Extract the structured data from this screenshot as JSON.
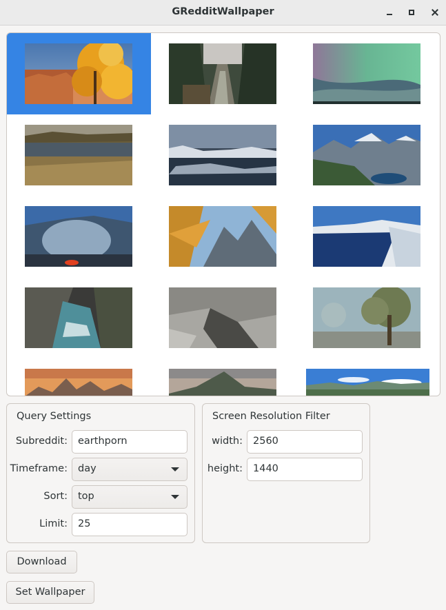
{
  "window": {
    "title": "GRedditWallpaper"
  },
  "gallery": {
    "selected_index": 0,
    "colors": {
      "selection": "#3584e4"
    },
    "thumbnails": [
      {
        "name": "canyon-autumn-tree"
      },
      {
        "name": "forest-stream"
      },
      {
        "name": "aurora-borealis"
      },
      {
        "name": "marsh-rainbow"
      },
      {
        "name": "icy-fjord"
      },
      {
        "name": "mountain-lake"
      },
      {
        "name": "volcano-crater"
      },
      {
        "name": "larch-peaks"
      },
      {
        "name": "crater-lake"
      },
      {
        "name": "river-gorge"
      },
      {
        "name": "cliff-face"
      },
      {
        "name": "misty-oak"
      },
      {
        "name": "dolomites-sunset"
      },
      {
        "name": "valley-peak"
      },
      {
        "name": "blue-sky-panorama"
      }
    ]
  },
  "query_settings": {
    "title": "Query Settings",
    "subreddit_label": "Subreddit:",
    "subreddit_value": "earthporn",
    "timeframe_label": "Timeframe:",
    "timeframe_value": "day",
    "sort_label": "Sort:",
    "sort_value": "top",
    "limit_label": "Limit:",
    "limit_value": "25"
  },
  "resolution_filter": {
    "title": "Screen Resolution Filter",
    "width_label": "width:",
    "width_value": "2560",
    "height_label": "height:",
    "height_value": "1440"
  },
  "actions": {
    "download_label": "Download",
    "set_wallpaper_label": "Set Wallpaper"
  }
}
